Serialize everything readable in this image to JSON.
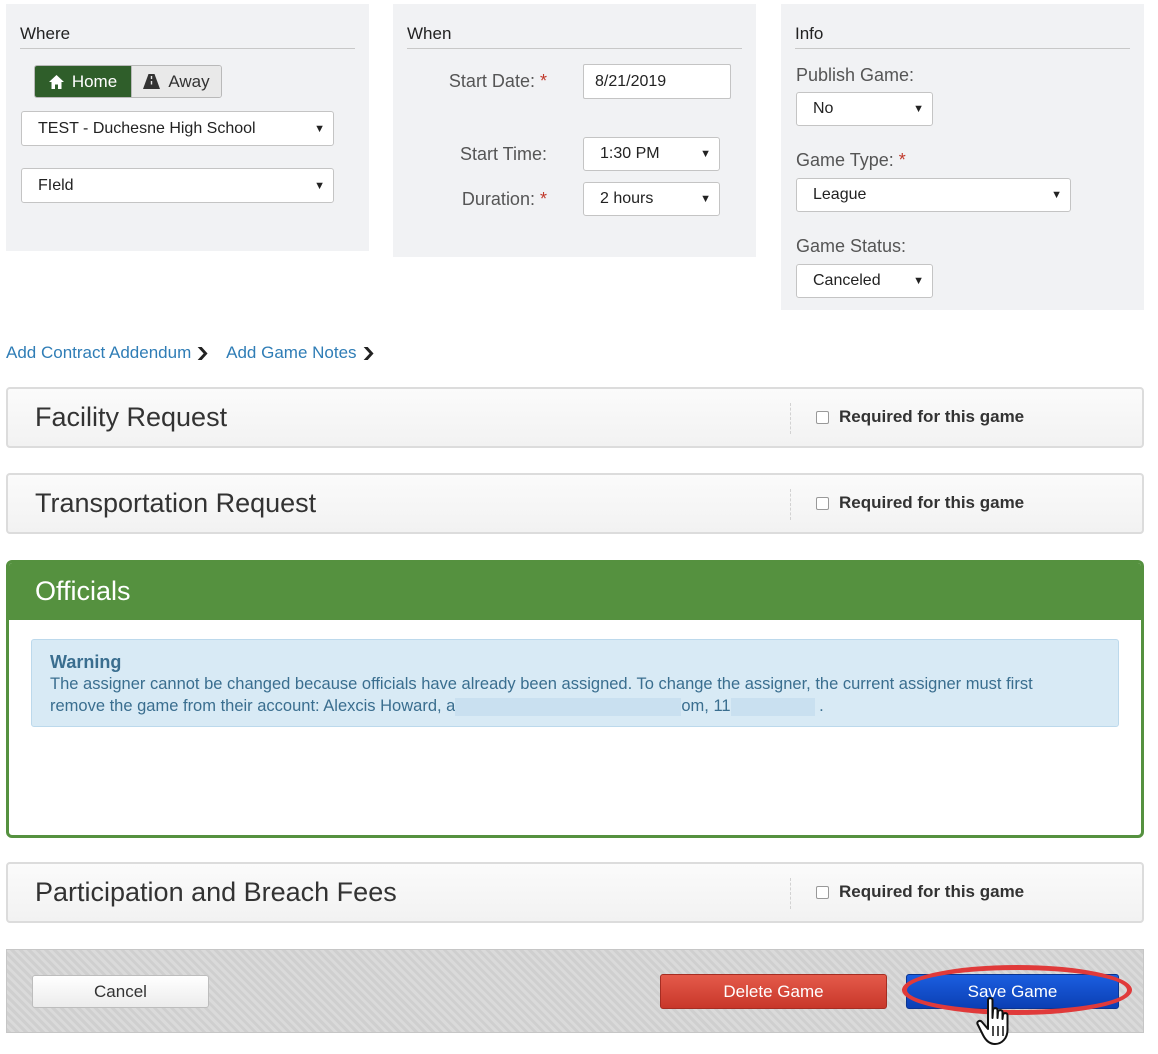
{
  "where": {
    "title": "Where",
    "home_label": "Home",
    "away_label": "Away",
    "school_value": "TEST - Duchesne High School",
    "field_value": "FIeld"
  },
  "when": {
    "title": "When",
    "start_date_label": "Start Date:",
    "start_date_value": "8/21/2019",
    "start_time_label": "Start Time:",
    "start_time_value": "1:30 PM",
    "duration_label": "Duration:",
    "duration_value": "2 hours"
  },
  "info": {
    "title": "Info",
    "publish_label": "Publish Game:",
    "publish_value": "No",
    "game_type_label": "Game Type:",
    "game_type_value": "League",
    "game_status_label": "Game Status:",
    "game_status_value": "Canceled"
  },
  "required_marker": "*",
  "links": {
    "contract_addendum": "Add Contract Addendum",
    "game_notes": "Add Game Notes"
  },
  "sections": {
    "facility": {
      "title": "Facility Request",
      "required_label": "Required for this game"
    },
    "transportation": {
      "title": "Transportation Request",
      "required_label": "Required for this game"
    },
    "fees": {
      "title": "Participation and Breach Fees",
      "required_label": "Required for this game"
    }
  },
  "officials": {
    "title": "Officials",
    "warning_title": "Warning",
    "warning_line1": "The assigner cannot be changed because officials have already been assigned. To change the assigner, the current assigner must first",
    "warning_line2_start": "remove the game from their account: Alexcis Howard, a",
    "warning_line2_mid": "om, 11",
    "warning_line2_end": "."
  },
  "footer": {
    "cancel_label": "Cancel",
    "delete_label": "Delete Game",
    "save_label": "Save Game"
  },
  "colors": {
    "officials_green": "#55913f",
    "home_active": "#2f5e2a",
    "save_blue": "#0b3fb4",
    "delete_red": "#c8372a",
    "highlight_red": "#e03a3a",
    "link_blue": "#2f7db6"
  }
}
